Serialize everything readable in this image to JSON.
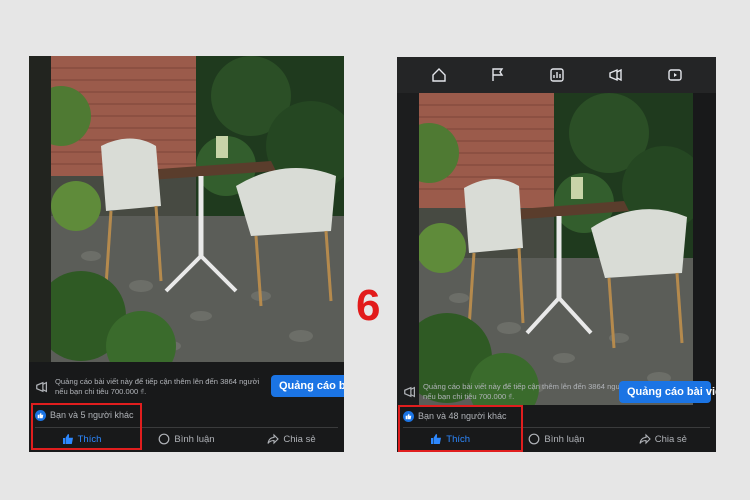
{
  "step_number": "6",
  "left_phone": {
    "promo_text": "Quảng cáo bài viết này để tiếp cận thêm lên đến 3864 người nếu bạn chi tiêu 700.000 ₫.",
    "promo_button": "Quảng cáo bài",
    "reactions_text": "Bạn và 5 người khác",
    "actions": {
      "like": "Thích",
      "comment": "Bình luận",
      "share": "Chia sẻ"
    }
  },
  "right_phone": {
    "nav_icons": [
      "home-icon",
      "flag-icon",
      "dashboard-icon",
      "megaphone-icon",
      "video-icon"
    ],
    "promo_text": "Quảng cáo bài viết này để tiếp cận thêm lên đến 3864 người nếu bạn chi tiêu 700.000 ₫.",
    "promo_button": "Quảng cáo bài viết",
    "reactions_text": "Bạn và 48 người khác",
    "actions": {
      "like": "Thích",
      "comment": "Bình luận",
      "share": "Chia sẻ"
    }
  },
  "colors": {
    "background": "#e6e6e6",
    "phone_bg": "#18191a",
    "accent": "#1b74e4",
    "liked": "#2d88ff",
    "highlight": "#e01e1e"
  }
}
